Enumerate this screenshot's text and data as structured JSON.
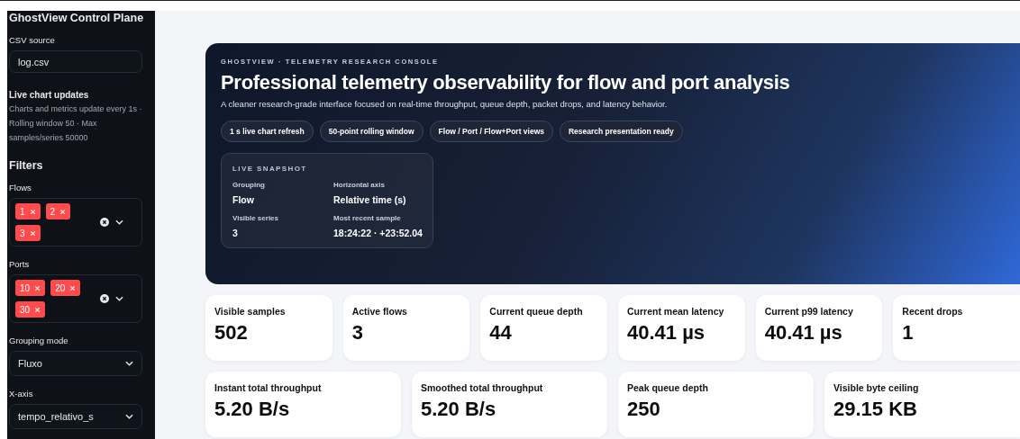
{
  "sidebar": {
    "title": "GhostView Control Plane",
    "csv": {
      "label": "CSV source",
      "value": "log.csv"
    },
    "live": {
      "title": "Live chart updates",
      "text": "Charts and metrics update every 1s · Rolling window 50 · Max samples/series 50000"
    },
    "filters_title": "Filters",
    "multiselects": [
      {
        "label": "Flows",
        "chips": [
          "1",
          "2",
          "3"
        ]
      },
      {
        "label": "Ports",
        "chips": [
          "10",
          "20",
          "30"
        ]
      }
    ],
    "selects": [
      {
        "label": "Grouping mode",
        "value": "Fluxo"
      },
      {
        "label": "X-axis",
        "value": "tempo_relativo_s"
      }
    ]
  },
  "hero": {
    "eyebrow": "GHOSTVIEW · TELEMETRY RESEARCH CONSOLE",
    "title": "Professional telemetry observability for flow and port analysis",
    "subtitle": "A cleaner research-grade interface focused on real-time throughput, queue depth, packet drops, and latency behavior.",
    "pills": [
      "1 s live chart refresh",
      "50-point rolling window",
      "Flow / Port / Flow+Port views",
      "Research presentation ready"
    ],
    "snapshot": {
      "title": "LIVE SNAPSHOT",
      "items": [
        {
          "label": "Grouping",
          "value": "Flow"
        },
        {
          "label": "Horizontal axis",
          "value": "Relative time (s)"
        },
        {
          "label": "Visible series",
          "value": "3"
        },
        {
          "label": "Most recent sample",
          "value": "18:24:22 · +23:52.04"
        }
      ]
    }
  },
  "metric_rows": [
    [
      {
        "label": "Visible samples",
        "value": "502"
      },
      {
        "label": "Active flows",
        "value": "3"
      },
      {
        "label": "Current queue depth",
        "value": "44"
      },
      {
        "label": "Current mean latency",
        "value": "40.41 µs"
      },
      {
        "label": "Current p99 latency",
        "value": "40.41 µs"
      },
      {
        "label": "Recent drops",
        "value": "1"
      }
    ],
    [
      {
        "label": "Instant total throughput",
        "value": "5.20 B/s"
      },
      {
        "label": "Smoothed total throughput",
        "value": "5.20 B/s"
      },
      {
        "label": "Peak queue depth",
        "value": "250"
      },
      {
        "label": "Visible byte ceiling",
        "value": "29.15 KB"
      }
    ]
  ]
}
